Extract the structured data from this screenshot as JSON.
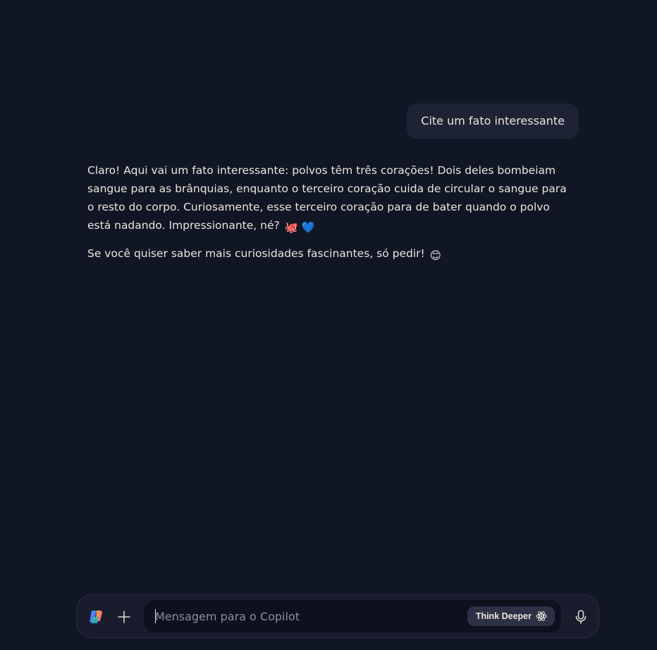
{
  "conversation": {
    "user_message": "Cite um fato interessante",
    "assistant_paragraph_1": "Claro! Aqui vai um fato interessante: polvos têm três corações! Dois deles bombeiam sangue para as brânquias, enquanto o terceiro coração cuida de circular o sangue para o resto do corpo. Curiosamente, esse terceiro coração para de bater quando o polvo está nadando. Impressionante, né?",
    "assistant_paragraph_1_emojis": "🐙 💙",
    "assistant_paragraph_2": "Se você quiser saber mais curiosidades fascinantes, só pedir!",
    "assistant_paragraph_2_emoji": "😊"
  },
  "composer": {
    "placeholder": "Mensagem para o Copilot",
    "think_deeper_label": "Think Deeper",
    "icons": {
      "logo": "copilot-logo-icon",
      "add": "plus-icon",
      "think": "atom-icon",
      "mic": "microphone-icon"
    }
  },
  "colors": {
    "background": "#111625",
    "user_bubble": "#1e2235",
    "text": "#ece5dc",
    "composer": "#181c2c",
    "input": "#0d111d",
    "think_button": "#2e3146"
  }
}
